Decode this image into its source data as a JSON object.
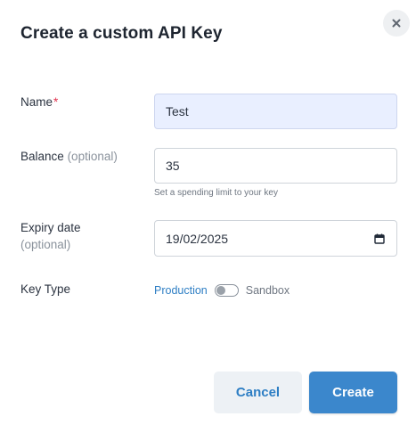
{
  "dialog": {
    "title": "Create a custom API Key",
    "close_icon": "close-icon"
  },
  "form": {
    "name": {
      "label": "Name",
      "required_mark": "*",
      "value": "Test"
    },
    "balance": {
      "label": "Balance",
      "label_suffix": "(optional)",
      "value": "35",
      "hint": "Set a spending limit to your key"
    },
    "expiry": {
      "label_line1": "Expiry date",
      "label_line2": "(optional)",
      "value": "19/02/2025",
      "icon": "calendar-icon"
    },
    "key_type": {
      "label": "Key Type",
      "option_left": "Production",
      "option_right": "Sandbox",
      "toggle_state": "off"
    }
  },
  "actions": {
    "cancel_label": "Cancel",
    "create_label": "Create"
  },
  "colors": {
    "accent": "#3b87cc",
    "link": "#2d7ec4",
    "required": "#e0334f",
    "filled_input_bg": "#e9efff"
  }
}
